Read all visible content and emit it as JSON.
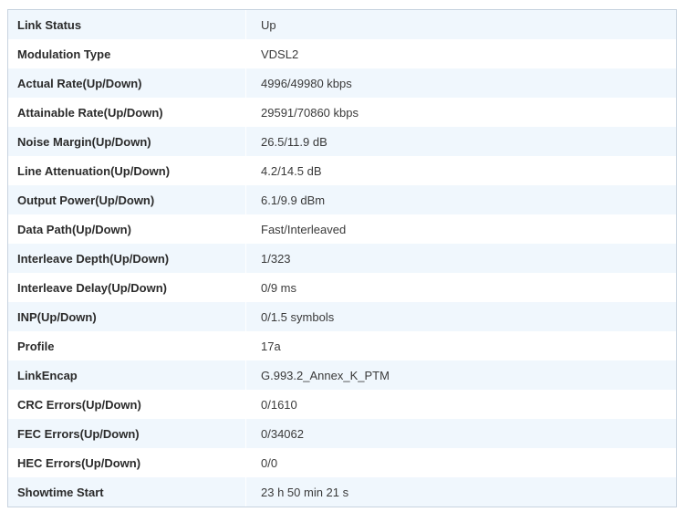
{
  "dsl_status": {
    "rows": [
      {
        "label": "Link Status",
        "value": "Up"
      },
      {
        "label": "Modulation Type",
        "value": "VDSL2"
      },
      {
        "label": "Actual Rate(Up/Down)",
        "value": "4996/49980 kbps"
      },
      {
        "label": "Attainable Rate(Up/Down)",
        "value": "29591/70860 kbps"
      },
      {
        "label": "Noise Margin(Up/Down)",
        "value": "26.5/11.9 dB"
      },
      {
        "label": "Line Attenuation(Up/Down)",
        "value": "4.2/14.5 dB"
      },
      {
        "label": "Output Power(Up/Down)",
        "value": "6.1/9.9 dBm"
      },
      {
        "label": "Data Path(Up/Down)",
        "value": "Fast/Interleaved"
      },
      {
        "label": "Interleave Depth(Up/Down)",
        "value": "1/323"
      },
      {
        "label": "Interleave Delay(Up/Down)",
        "value": "0/9 ms"
      },
      {
        "label": "INP(Up/Down)",
        "value": "0/1.5 symbols"
      },
      {
        "label": "Profile",
        "value": "17a"
      },
      {
        "label": "LinkEncap",
        "value": "G.993.2_Annex_K_PTM"
      },
      {
        "label": "CRC Errors(Up/Down)",
        "value": "0/1610"
      },
      {
        "label": "FEC Errors(Up/Down)",
        "value": "0/34062"
      },
      {
        "label": "HEC Errors(Up/Down)",
        "value": "0/0"
      },
      {
        "label": "Showtime Start",
        "value": "23 h 50 min 21 s"
      }
    ]
  }
}
